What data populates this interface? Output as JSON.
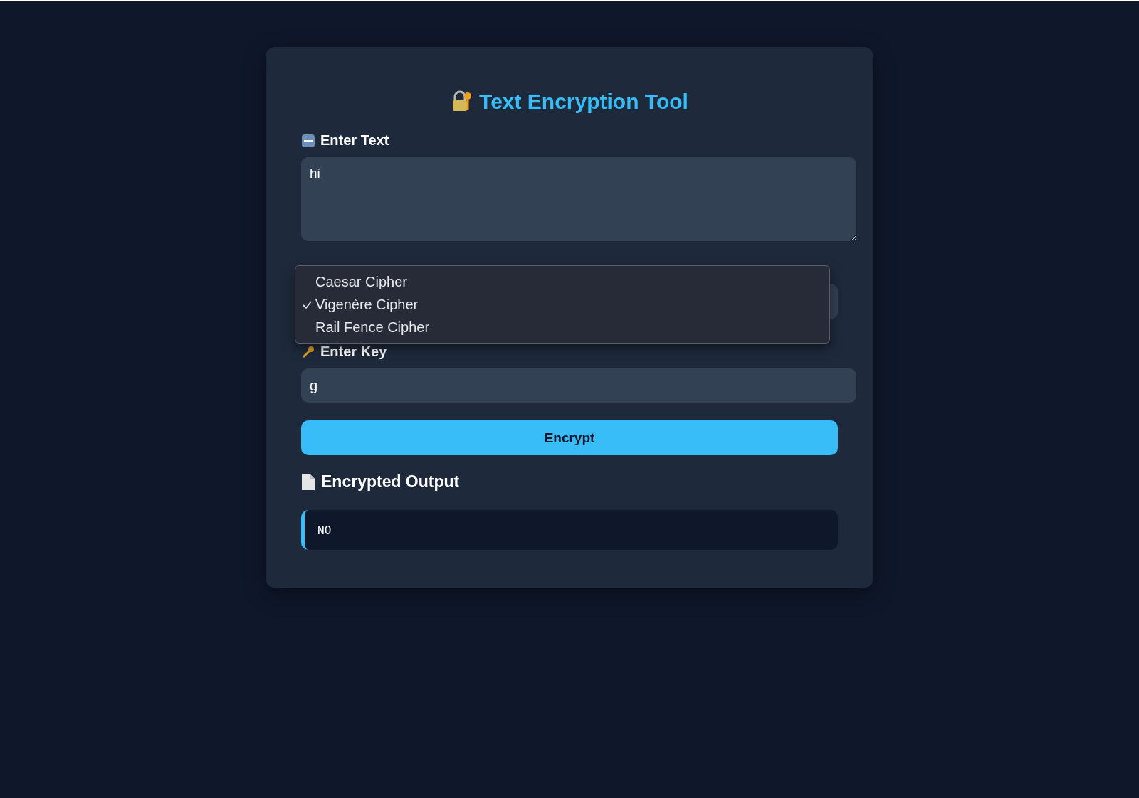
{
  "title": "Text Encryption Tool",
  "text_field": {
    "label": "Enter Text",
    "value": "hi"
  },
  "algorithm": {
    "options": [
      {
        "label": "Caesar Cipher",
        "selected": false
      },
      {
        "label": "Vigenère Cipher",
        "selected": true
      },
      {
        "label": "Rail Fence Cipher",
        "selected": false
      }
    ]
  },
  "key_field": {
    "label": "Enter Key",
    "value": "g"
  },
  "button": "Encrypt",
  "output": {
    "heading": "Encrypted Output",
    "value": "NO"
  }
}
